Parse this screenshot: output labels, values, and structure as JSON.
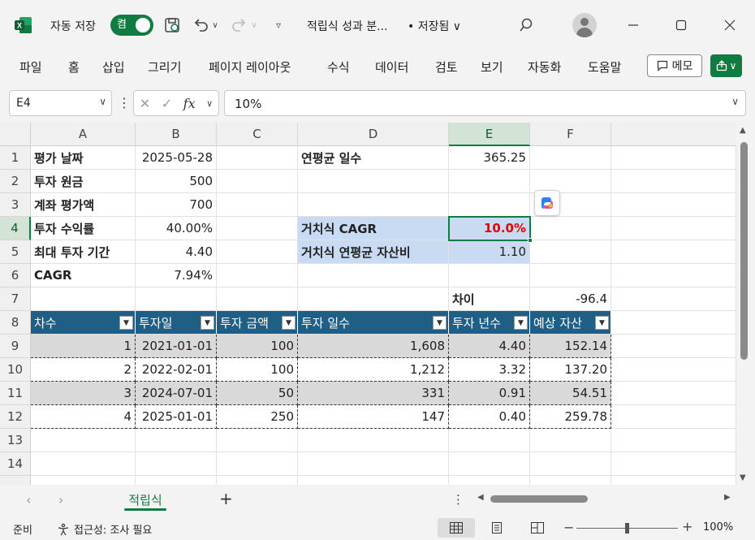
{
  "app": {
    "autosave_label": "자동 저장",
    "autosave_state": "켬",
    "doc_title": "적립식 성과 분...",
    "doc_saved": "• 저장됨 ∨",
    "accent": "#107c41"
  },
  "ribbon": {
    "tabs": [
      "파일",
      "홈",
      "삽입",
      "그리기",
      "페이지 레이아웃",
      "수식",
      "데이터",
      "검토",
      "보기",
      "자동화",
      "도움말"
    ],
    "memo_label": "메모"
  },
  "formula_bar": {
    "name_box": "E4",
    "fx": "fx",
    "formula": "10%"
  },
  "grid": {
    "columns": [
      "A",
      "B",
      "C",
      "D",
      "E",
      "F"
    ],
    "rows": [
      "1",
      "2",
      "3",
      "4",
      "5",
      "6",
      "7",
      "8",
      "9",
      "10",
      "11",
      "12",
      "13",
      "14"
    ],
    "selected_column": "E",
    "selected_row": "4",
    "summary": {
      "a1": "평가 날짜",
      "b1": "2025-05-28",
      "a2": "투자 원금",
      "b2": "500",
      "a3": "계좌 평가액",
      "b3": "700",
      "a4": "투자 수익률",
      "b4": "40.00%",
      "a5": "최대 투자 기간",
      "b5": "4.40",
      "a6": "CAGR",
      "b6": "7.94%",
      "d1": "연평균 일수",
      "e1": "365.25",
      "d4": "거치식 CAGR",
      "e4": "10.0%",
      "d5": "거치식 연평균 자산비",
      "e5": "1.10",
      "e7": "차이",
      "f7": "-96.4"
    },
    "table": {
      "headers": [
        "차수",
        "투자일",
        "투자 금액",
        "투자 일수",
        "투자 년수",
        "예상 자산"
      ],
      "rows": [
        [
          "1",
          "2021-01-01",
          "100",
          "1,608",
          "4.40",
          "152.14"
        ],
        [
          "2",
          "2022-02-01",
          "100",
          "1,212",
          "3.32",
          "137.20"
        ],
        [
          "3",
          "2024-07-01",
          "50",
          "331",
          "0.91",
          "54.51"
        ],
        [
          "4",
          "2025-01-01",
          "250",
          "147",
          "0.40",
          "259.78"
        ]
      ]
    }
  },
  "sheets": {
    "active": "적립식",
    "add_label": "+"
  },
  "status": {
    "ready": "준비",
    "accessibility": "접근성: 조사 필요",
    "zoom": "100%"
  }
}
